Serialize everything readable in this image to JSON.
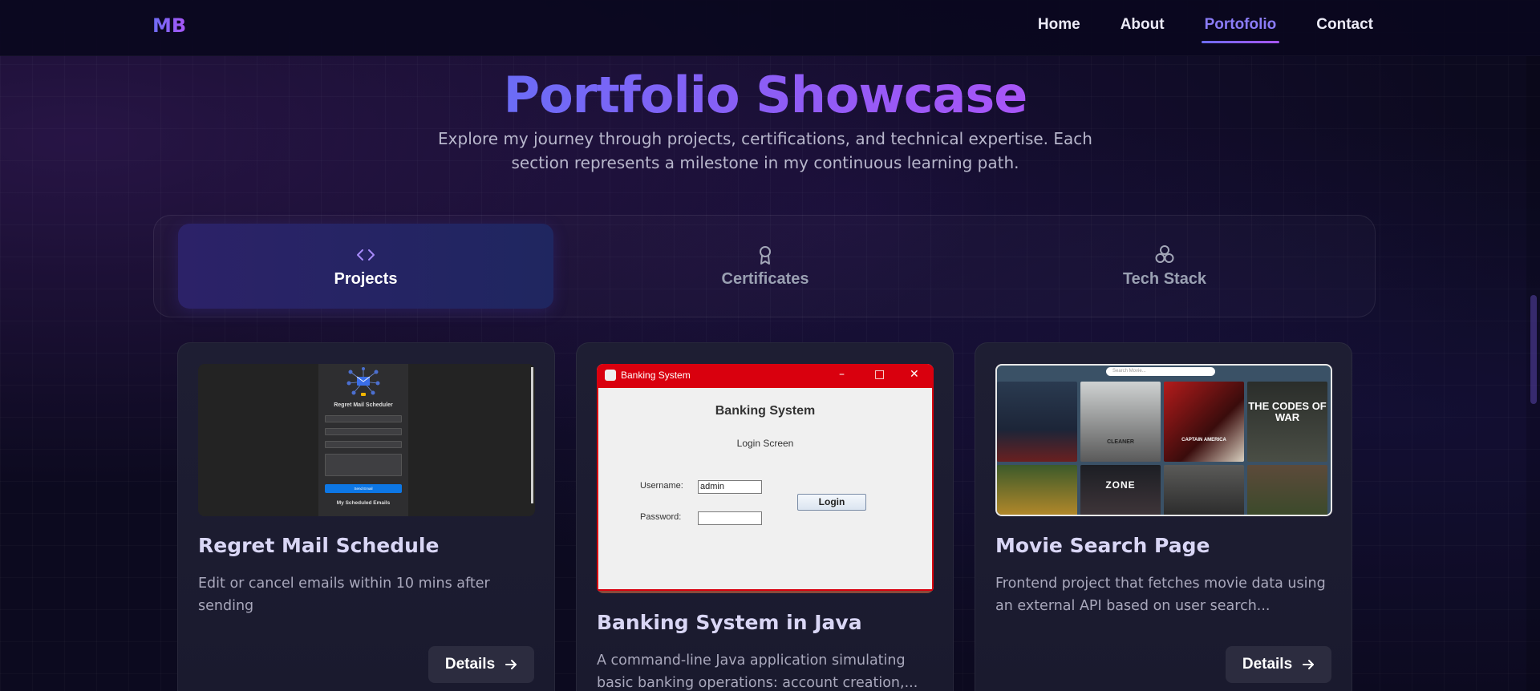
{
  "nav": {
    "logo": "MB",
    "links": [
      "Home",
      "About",
      "Portofolio",
      "Contact"
    ],
    "active": "Portofolio"
  },
  "hero": {
    "title": "Portfolio Showcase",
    "subtitle": "Explore my journey through projects, certifications, and technical expertise. Each section represents a milestone in my continuous learning path."
  },
  "tabs": [
    {
      "label": "Projects",
      "icon": "code-icon",
      "active": true
    },
    {
      "label": "Certificates",
      "icon": "award-icon",
      "active": false
    },
    {
      "label": "Tech Stack",
      "icon": "boxes-icon",
      "active": false
    }
  ],
  "cards": [
    {
      "title": "Regret Mail Schedule",
      "description": "Edit or cancel emails within 10 mins after sending",
      "button": "Details",
      "thumb": {
        "heading": "Regret Mail Scheduler",
        "send": "Send Email",
        "list": "My Scheduled Emails"
      }
    },
    {
      "title": "Banking System in Java",
      "description": "A command-line Java application simulating basic banking operations: account creation,...",
      "thumb": {
        "window_title": "Banking System",
        "heading": "Banking System",
        "sub": "Login Screen",
        "username_label": "Username:",
        "username_value": "admin",
        "password_label": "Password:",
        "login": "Login"
      }
    },
    {
      "title": "Movie Search Page",
      "description": "Frontend project that fetches movie data using an external API based on user search...",
      "button": "Details",
      "thumb": {
        "search_placeholder": "Search Movie...",
        "posters": [
          "",
          "CLEANER",
          "CAPTAIN AMERICA",
          "THE CODES OF WAR",
          "",
          "ZONE",
          "",
          ""
        ]
      }
    }
  ],
  "colors": {
    "accent": "#8b7cf8",
    "gradient_start": "#6b6cf6",
    "gradient_end": "#a855f7",
    "background": "#0c0a1f"
  }
}
